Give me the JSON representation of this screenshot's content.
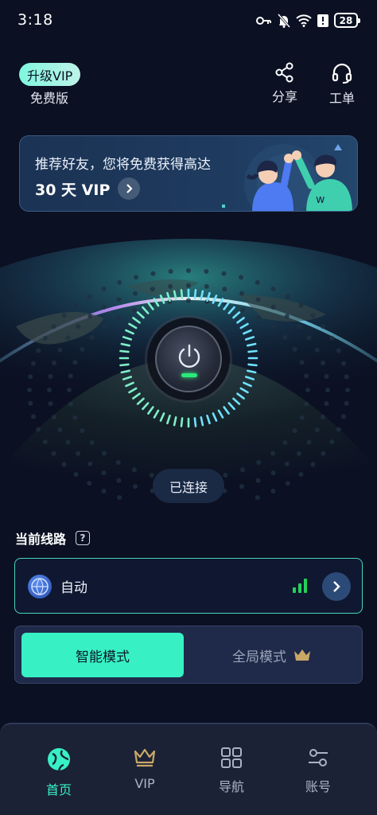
{
  "status_bar": {
    "time": "3:18",
    "battery": "28"
  },
  "header": {
    "vip_badge": "升级VIP",
    "plan": "免费版",
    "share_label": "分享",
    "ticket_label": "工单"
  },
  "banner": {
    "line1": "推荐好友，您将免费获得高达",
    "line2": "30 天 VIP"
  },
  "connection": {
    "status": "已连接"
  },
  "route": {
    "section_title": "当前线路",
    "help": "?",
    "name": "自动"
  },
  "mode": {
    "smart": "智能模式",
    "global": "全局模式"
  },
  "tabs": [
    {
      "label": "首页",
      "icon": "globe-icon"
    },
    {
      "label": "VIP",
      "icon": "crown-icon"
    },
    {
      "label": "导航",
      "icon": "grid-icon"
    },
    {
      "label": "账号",
      "icon": "sliders-icon"
    }
  ],
  "colors": {
    "accent": "#37f1c4",
    "background": "#0b1022",
    "signal": "#25d15a",
    "vip_gold": "#c9a766"
  }
}
